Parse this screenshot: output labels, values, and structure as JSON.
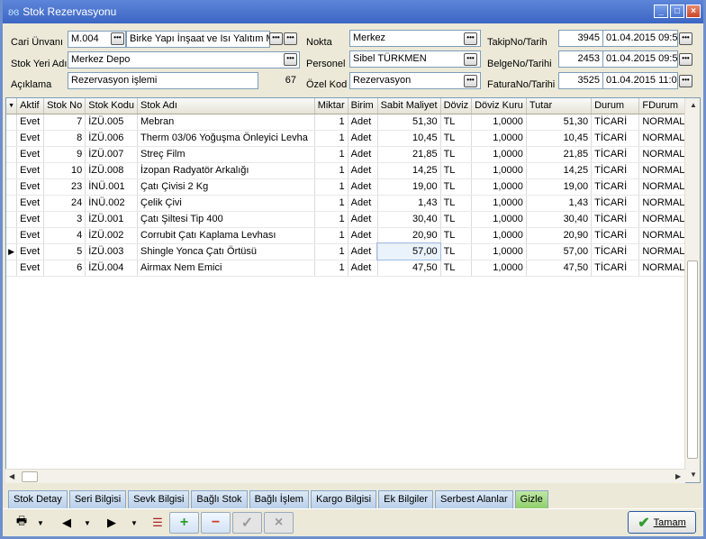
{
  "window": {
    "title": "Stok Rezervasyonu"
  },
  "form": {
    "cari_label": "Cari Ünvanı",
    "cari_code": "M.004",
    "cari_name": "Birke Yapı İnşaat ve Isı Yalıtım M",
    "stok_yeri_label": "Stok Yeri Adı",
    "stok_yeri": "Merkez Depo",
    "aciklama_label": "Açıklama",
    "aciklama": "Rezervasyon işlemi",
    "aciklama_count": "67",
    "nokta_label": "Nokta",
    "nokta": "Merkez",
    "personel_label": "Personel",
    "personel": "Sibel TÜRKMEN",
    "ozel_kod_label": "Özel Kod",
    "ozel_kod": "Rezervasyon",
    "takip_label": "TakipNo/Tarih",
    "takip_no": "3945",
    "takip_tarih": "01.04.2015 09:5",
    "belge_label": "BelgeNo/Tarihi",
    "belge_no": "2453",
    "belge_tarih": "01.04.2015 09:5",
    "fatura_label": "FaturaNo/Tarihi",
    "fatura_no": "3525",
    "fatura_tarih": "01.04.2015 11:0"
  },
  "grid": {
    "columns": [
      "Aktif",
      "Stok No",
      "Stok Kodu",
      "Stok Adı",
      "Miktar",
      "Birim",
      "Sabit Maliyet",
      "Döviz",
      "Döviz Kuru",
      "Tutar",
      "Durum",
      "FDurum"
    ],
    "rows": [
      [
        "Evet",
        "7",
        "İZÜ.005",
        "Mebran",
        "1",
        "Adet",
        "51,30",
        "TL",
        "1,0000",
        "51,30",
        "TİCARİ",
        "NORMAL"
      ],
      [
        "Evet",
        "8",
        "İZÜ.006",
        "Therm 03/06 Yoğuşma Önleyici Levha",
        "1",
        "Adet",
        "10,45",
        "TL",
        "1,0000",
        "10,45",
        "TİCARİ",
        "NORMAL"
      ],
      [
        "Evet",
        "9",
        "İZÜ.007",
        "Streç Film",
        "1",
        "Adet",
        "21,85",
        "TL",
        "1,0000",
        "21,85",
        "TİCARİ",
        "NORMAL"
      ],
      [
        "Evet",
        "10",
        "İZÜ.008",
        "İzopan Radyatör Arkalığı",
        "1",
        "Adet",
        "14,25",
        "TL",
        "1,0000",
        "14,25",
        "TİCARİ",
        "NORMAL"
      ],
      [
        "Evet",
        "23",
        "İNÜ.001",
        "Çatı Çivisi 2 Kg",
        "1",
        "Adet",
        "19,00",
        "TL",
        "1,0000",
        "19,00",
        "TİCARİ",
        "NORMAL"
      ],
      [
        "Evet",
        "24",
        "İNÜ.002",
        "Çelik Çivi",
        "1",
        "Adet",
        "1,43",
        "TL",
        "1,0000",
        "1,43",
        "TİCARİ",
        "NORMAL"
      ],
      [
        "Evet",
        "3",
        "İZÜ.001",
        "Çatı Şiltesi Tip 400",
        "1",
        "Adet",
        "30,40",
        "TL",
        "1,0000",
        "30,40",
        "TİCARİ",
        "NORMAL"
      ],
      [
        "Evet",
        "4",
        "İZÜ.002",
        "Corrubit Çatı Kaplama Levhası",
        "1",
        "Adet",
        "20,90",
        "TL",
        "1,0000",
        "20,90",
        "TİCARİ",
        "NORMAL"
      ],
      [
        "Evet",
        "5",
        "İZÜ.003",
        "Shingle Yonca Çatı Örtüsü",
        "1",
        "Adet",
        "57,00",
        "TL",
        "1,0000",
        "57,00",
        "TİCARİ",
        "NORMAL"
      ],
      [
        "Evet",
        "6",
        "İZÜ.004",
        "Airmax Nem Emici",
        "1",
        "Adet",
        "47,50",
        "TL",
        "1,0000",
        "47,50",
        "TİCARİ",
        "NORMAL"
      ]
    ],
    "current_row": 8
  },
  "tabs": [
    "Stok Detay",
    "Seri Bilgisi",
    "Sevk Bilgisi",
    "Bağlı Stok",
    "Bağlı İşlem",
    "Kargo Bilgisi",
    "Ek Bilgiler",
    "Serbest Alanlar",
    "Gizle"
  ],
  "toolbar": {
    "ok_label": "Tamam"
  },
  "icons": {
    "app": "butterfly-icon",
    "print": "printer-icon",
    "back": "arrow-left-icon",
    "forward": "arrow-right-icon",
    "list": "checklist-icon",
    "add": "plus-icon",
    "delete": "minus-icon",
    "confirm": "check-icon",
    "cancel": "x-icon"
  },
  "colors": {
    "accent_green": "#2e9e2e",
    "delete_red": "#d23a2a"
  }
}
